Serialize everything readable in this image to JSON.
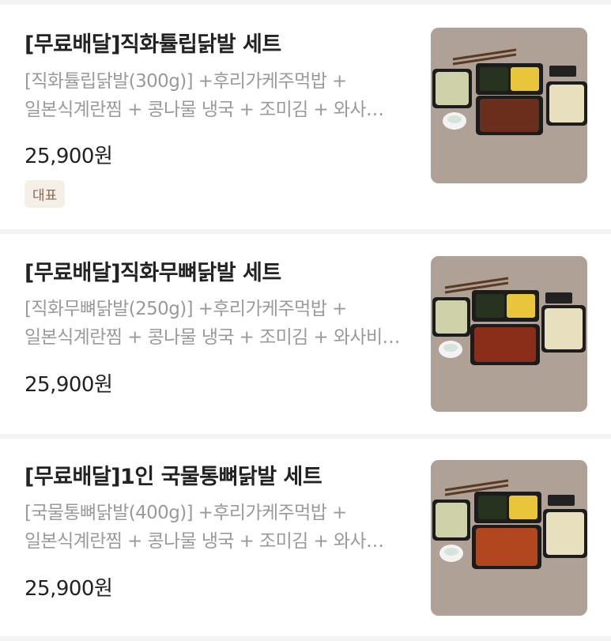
{
  "menu_items": [
    {
      "title": "[무료배달]직화튤립닭발 세트",
      "description": "[직화튤립닭발(300g)] +후리가케주먹밥 + 일본식계란찜 + 콩나물 냉국 + 조미김  + 와사…",
      "price": "25,900원",
      "badge": "대표",
      "image": "meal-set-photo"
    },
    {
      "title": "[무료배달]직화무뼈닭발 세트",
      "description": "[직화무뼈닭발(250g)] +후리가케주먹밥 + 일본식계란찜 + 콩나물 냉국 + 조미김  + 와사비…",
      "price": "25,900원",
      "image": "meal-set-photo"
    },
    {
      "title": "[무료배달]1인 국물통뼈닭발 세트",
      "description": "[국물통뼈닭발(400g)] +후리가케주먹밥 + 일본식계란찜 + 콩나물 냉국 + 조미김  + 와사…",
      "price": "25,900원",
      "image": "meal-set-photo"
    }
  ]
}
